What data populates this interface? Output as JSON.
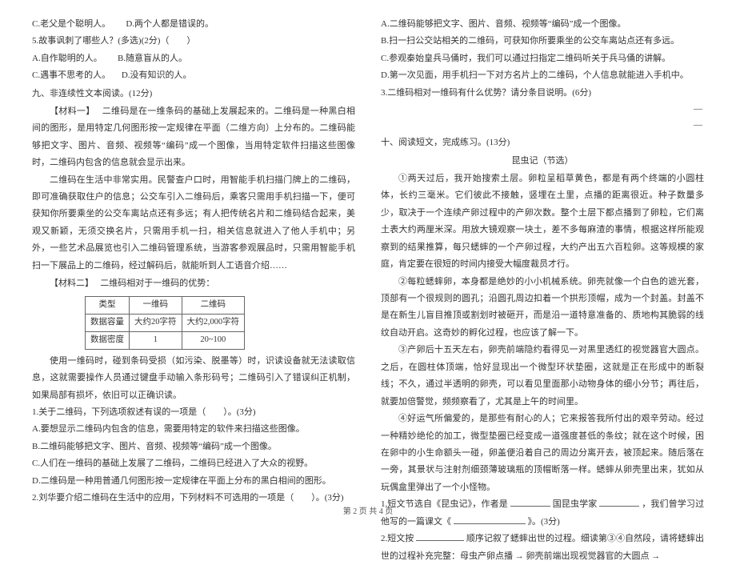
{
  "left": {
    "q4c": "C.老父是个聪明人。",
    "q4d": "D.两个人都是错误的。",
    "q5": "5.故事讽刺了哪些人？(多选)(2分)（　　）",
    "q5a": "A.自作聪明的人。",
    "q5b": "B.随意盲从的人。",
    "q5c": "C.遇事不思考的人。",
    "q5d": "D.没有知识的人。",
    "sec9": "九、非连续性文本阅读。(12分)",
    "mat1_title": "【材料一】",
    "mat1_p1a": "二维码是在一维条码的基础上发展起来的。二维码是一种黑白相间的图形，是用特定几何图形按一定规律在平面（二维方向）上分布的。二维码能够把文字、图片、音频、视频等“编码”成一个图像，当用特定软件扫描这些图像时，二维码内包含的信息就会显示出来。",
    "mat1_p2": "二维码在生活中非常实用。民警查户口时，用智能手机扫描门牌上的二维码，即可准确获取住户的信息；公交车引入二维码后，乘客只需用手机扫描一下，便可获知你所要乘坐的公交车离站点还有多远；有人把传统名片和二维码结合起来，美观又新颖，无须交换名片，只需用手机一扫，相关信息就进入了他人手机中；另外，一些艺术品展览也引入二维码管理系统，当游客参观展品时，只需用智能手机扫一下展品上的二维码，经过解码后，就能听到人工语音介绍……",
    "mat2_title": "【材料二】",
    "mat2_txt": "二维码相对于一维码的优势：",
    "table": {
      "r1": [
        "类型",
        "一维码",
        "二维码"
      ],
      "r2": [
        "数据容量",
        "大约20字符",
        "大约2,000字符"
      ],
      "r3": [
        "数据密度",
        "1",
        "20~100"
      ]
    },
    "mat2_p": "使用一维码时，碰到条码受损（如污染、脱墨等）时，识读设备就无法读取信息，这就需要操作人员通过键盘手动输入条形码号；二维码引入了错误纠正机制，如果局部有损坏，依旧可以正确识读。",
    "q9_1": "1.关于二维码，下列选项叙述有误的一项是（　　）。(3分)",
    "q9_1a": "A.要想显示二维码内包含的信息，需要用特定的软件来扫描这些图像。",
    "q9_1b": "B.二维码能够把文字、图片、音频、视频等“编码”成一个图像。",
    "q9_1c": "C.人们在一维码的基础上发展了二维码，二维码已经进入了大众的视野。",
    "q9_1d": "D.二维码是一种用普通几何图形按一定规律在平面上分布的黑白相间的图形。",
    "q9_2": "2.刘华要介绍二维码在生活中的应用，下列材料不可选用的一项是（　　）。(3分)"
  },
  "right": {
    "q9_2a": "A.二维码能够把文字、图片、音频、视频等“编码”成一个图像。",
    "q9_2b": "B.扫一扫公交站相关的二维码，可获知你所要乘坐的公交车离站点还有多远。",
    "q9_2c": "C.参观秦始皇兵马俑时，我们可以通过扫指定二维码听关于兵马俑的讲解。",
    "q9_2d": "D.第一次见面，用手机扫一下对方名片上的二维码，个人信息就能进入手机中。",
    "q9_3": "3.二维码相对一维码有什么优势？请分条目说明。(6分)",
    "sec10": "十、阅读短文，完成练习。(13分)",
    "title10": "昆虫记（节选）",
    "p1": "①两天过后，我开始搜索土层。卵粒呈稻草黄色，都是有两个终端的小圆柱体，长约三毫米。它们彼此不接触，竖埋在土里，点播的距离很近。种子数量多少，取决于一个连续产卵过程中的产卵次数。整个土层下都点播到了卵粒，它们离土表大约两厘米深。用放大镜观察一块土，差不多每麻渣的事情，根据这样所能观察到的结果推算，每只蟋蟀的一个产卵过程，大约产出五六百粒卵。这等规模的家庭，肯定要在很短的时间内接受大幅度裁员才行。",
    "p2": "②每粒蟋蟀卵，本身都是绝妙的小小机械系统。卵壳就像一个白色的遮光套，顶部有一个很规则的圆孔；沿圆孔周边扣着一个拱形顶帽，成为一个封盖。封盖不是在新生儿盲目推顶或割划时被砸开，而是沿一道特意准备的、质地构其脆弱的线纹自动开启。这奇妙的孵化过程，也应该了解一下。",
    "p3": "③产卵后十五天左右，卵壳前端隐约看得见一对黑里透红的视觉器官大圆点。之后，在圆柱体顶端，恰好显现出一个微型环状垫圈，这就是正在形成中的断裂线；不久，通过半透明的卵壳，可以看见里面那小动物身体的细小分节；再往后，就要加倍警觉，频频察看了，尤其是上午的时间里。",
    "p4": "④好运气所偏爱的，是那些有耐心的人；它来报答我所付出的艰辛劳动。经过一种精妙绝伦的加工，微型垫圈已经变成一道强度甚低的条纹；就在这个时候，困在卵中的小生命额头一碰，卵盖便沿着自己的周边分离开去，被顶起来。随后落在一旁，其景状与注射剂细颈薄玻璃瓶的顶帽断落一样。蟋蟀从卵壳里出来，犹如从玩偶盒里弹出了一个小怪物。",
    "q10_1a": "1.短文节选自《昆虫记》，作者是",
    "q10_1b": "国昆虫学家",
    "q10_1c": "，我们曾学习过他写的一篇课文《",
    "q10_1d": "》。(3分)",
    "q10_2a": "2.短文按",
    "q10_2b": "顺序记叙了蟋蟀出世的过程。细读第③④自然段，请将蟋蟀出世的过程补充完整：母虫产卵点播 → 卵壳前端出现视觉器官的大圆点 →"
  },
  "footer": "第 2 页 共 4 页"
}
